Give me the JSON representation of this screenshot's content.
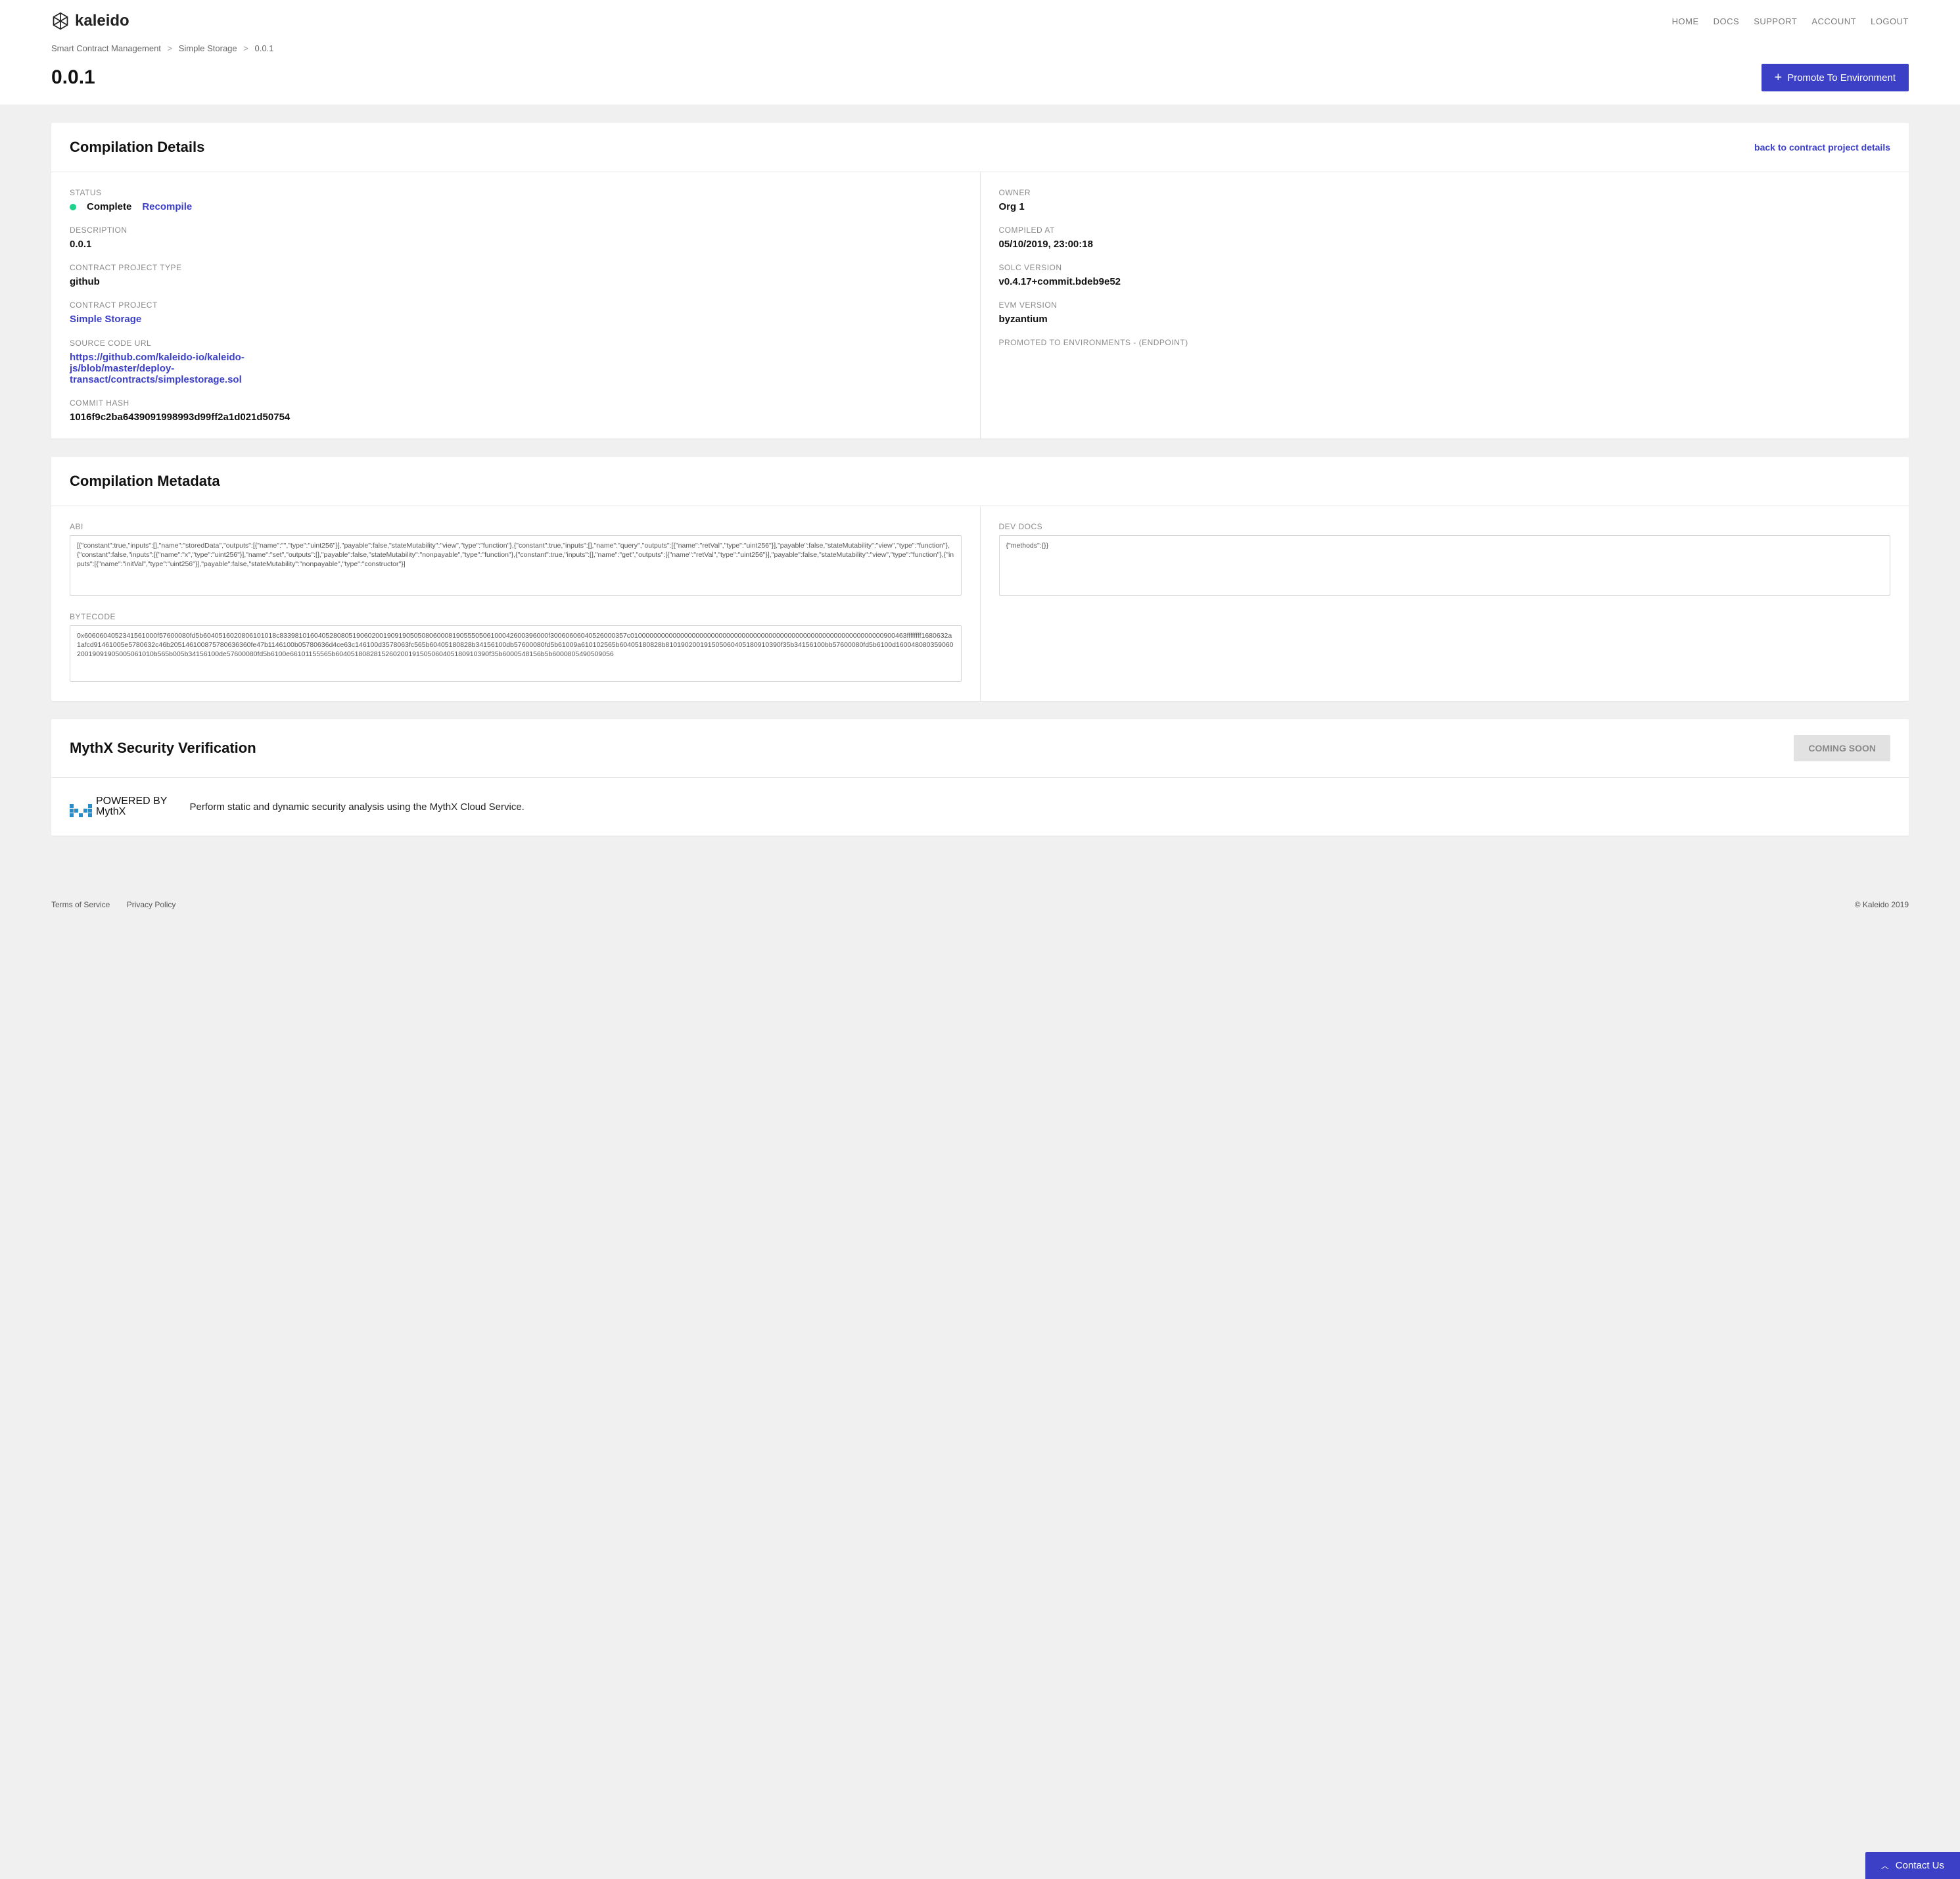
{
  "logo_text": "kaleido",
  "nav": {
    "home": "HOME",
    "docs": "DOCS",
    "support": "SUPPORT",
    "account": "ACCOUNT",
    "logout": "LOGOUT"
  },
  "breadcrumb": {
    "item1": "Smart Contract Management",
    "item2": "Simple Storage",
    "item3": "0.0.1"
  },
  "page_title": "0.0.1",
  "promote_btn": "Promote To Environment",
  "compilation_details": {
    "heading": "Compilation Details",
    "back_link": "back to contract project details",
    "status_label": "STATUS",
    "status_value": "Complete",
    "recompile": "Recompile",
    "description_label": "DESCRIPTION",
    "description_value": "0.0.1",
    "project_type_label": "CONTRACT PROJECT TYPE",
    "project_type_value": "github",
    "project_label": "CONTRACT PROJECT",
    "project_value": "Simple Storage",
    "source_url_label": "SOURCE CODE URL",
    "source_url_value": "https://github.com/kaleido-io/kaleido-js/blob/master/deploy-transact/contracts/simplestorage.sol",
    "commit_label": "COMMIT HASH",
    "commit_value": "1016f9c2ba6439091998993d99ff2a1d021d50754",
    "owner_label": "OWNER",
    "owner_value": "Org 1",
    "compiled_at_label": "COMPILED AT",
    "compiled_at_value": "05/10/2019, 23:00:18",
    "solc_label": "SOLC VERSION",
    "solc_value": "v0.4.17+commit.bdeb9e52",
    "evm_label": "EVM VERSION",
    "evm_value": "byzantium",
    "promoted_label": "PROMOTED TO ENVIRONMENTS - (ENDPOINT)"
  },
  "compilation_metadata": {
    "heading": "Compilation Metadata",
    "abi_label": "ABI",
    "abi_value": "[{\"constant\":true,\"inputs\":[],\"name\":\"storedData\",\"outputs\":[{\"name\":\"\",\"type\":\"uint256\"}],\"payable\":false,\"stateMutability\":\"view\",\"type\":\"function\"},{\"constant\":true,\"inputs\":[],\"name\":\"query\",\"outputs\":[{\"name\":\"retVal\",\"type\":\"uint256\"}],\"payable\":false,\"stateMutability\":\"view\",\"type\":\"function\"},{\"constant\":false,\"inputs\":[{\"name\":\"x\",\"type\":\"uint256\"}],\"name\":\"set\",\"outputs\":[],\"payable\":false,\"stateMutability\":\"nonpayable\",\"type\":\"function\"},{\"constant\":true,\"inputs\":[],\"name\":\"get\",\"outputs\":[{\"name\":\"retVal\",\"type\":\"uint256\"}],\"payable\":false,\"stateMutability\":\"view\",\"type\":\"function\"},{\"inputs\":[{\"name\":\"initVal\",\"type\":\"uint256\"}],\"payable\":false,\"stateMutability\":\"nonpayable\",\"type\":\"constructor\"}]",
    "bytecode_label": "BYTECODE",
    "bytecode_value": "0x6060604052341561000f57600080fd5b6040516020806101018c8339810160405280805190602001909190505080600081905550506100042600396000f30060606040526000357c010000000000000000000000000000000000000000000000000000000000000000900463ffffffff1680632a1afcd91461005e5780632c46b205146100875780636360fe47b1146100b05780636d4ce63c146100d3578063fc565b60405180828b34156100db57600080fd5b61009a610102565b60405180828b810190200191505060405180910390f35b34156100bb57600080fd5b6100d16004808035906020019091905005061010b565b005b34156100de57600080fd5b6100e66101155565b6040518082815260200191505060405180910390f35b6000548156b5b6000805490509056",
    "devdocs_label": "DEV DOCS",
    "devdocs_value": "{\"methods\":{}}"
  },
  "mythx": {
    "heading": "MythX Security Verification",
    "coming_soon": "COMING SOON",
    "powered": "POWERED BY",
    "name": "MythX",
    "desc": "Perform static and dynamic security analysis using the MythX Cloud Service."
  },
  "footer": {
    "tos": "Terms of Service",
    "privacy": "Privacy Policy",
    "copyright": "© Kaleido 2019"
  },
  "contact": "Contact Us"
}
